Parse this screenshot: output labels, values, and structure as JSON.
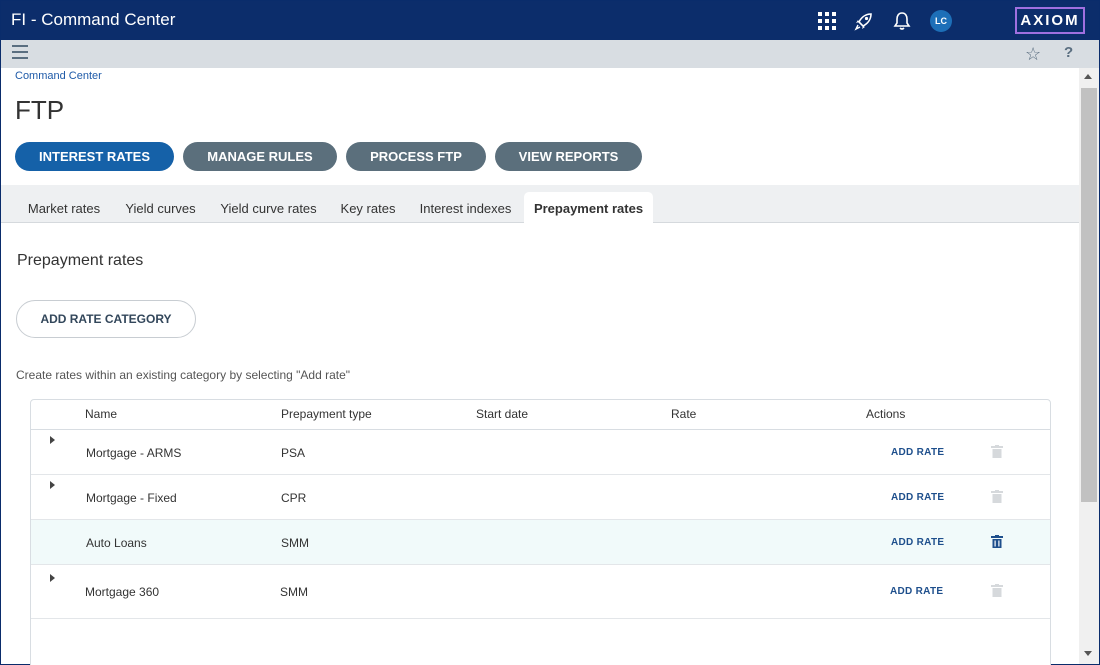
{
  "app": {
    "title": "FI - Command Center",
    "logo": "AXIOM",
    "avatar_initials": "LC"
  },
  "topbar_icons": [
    "apps-grid-icon",
    "rocket-icon",
    "bell-icon"
  ],
  "subbar_icons": [
    "menu-icon",
    "star-icon",
    "help-icon"
  ],
  "help_glyph": "?",
  "breadcrumb": "Command Center",
  "page_title": "FTP",
  "nav_buttons": [
    {
      "label": "INTEREST RATES",
      "active": true
    },
    {
      "label": "MANAGE RULES",
      "active": false
    },
    {
      "label": "PROCESS FTP",
      "active": false
    },
    {
      "label": "VIEW REPORTS",
      "active": false
    }
  ],
  "tabs": [
    {
      "label": "Market rates",
      "selected": false
    },
    {
      "label": "Yield curves",
      "selected": false
    },
    {
      "label": "Yield curve rates",
      "selected": false
    },
    {
      "label": "Key rates",
      "selected": false
    },
    {
      "label": "Interest indexes",
      "selected": false
    },
    {
      "label": "Prepayment rates",
      "selected": true
    }
  ],
  "section": {
    "title": "Prepayment rates",
    "add_category_label": "ADD RATE CATEGORY",
    "hint": "Create rates within an existing category by selecting \"Add rate\""
  },
  "table": {
    "columns": [
      "Name",
      "Prepayment type",
      "Start date",
      "Rate",
      "Actions"
    ],
    "add_rate_label": "ADD RATE",
    "rows": [
      {
        "name": "Mortgage - ARMS",
        "type": "PSA",
        "expandable": true,
        "delete_enabled": false,
        "highlighted": false
      },
      {
        "name": "Mortgage - Fixed",
        "type": "CPR",
        "expandable": true,
        "delete_enabled": false,
        "highlighted": false
      },
      {
        "name": "Auto Loans",
        "type": "SMM",
        "expandable": false,
        "delete_enabled": true,
        "highlighted": true
      },
      {
        "name": "Mortgage 360",
        "type": "SMM",
        "expandable": true,
        "delete_enabled": false,
        "highlighted": false
      }
    ]
  },
  "colors": {
    "topbar": "#0c2d6b",
    "primary": "#1561a8",
    "secondary": "#5b6f7c",
    "trash_enabled": "#1e4f8c",
    "trash_disabled": "#d6d9dc"
  }
}
